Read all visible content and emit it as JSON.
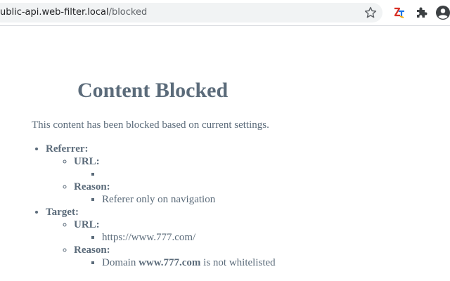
{
  "browser": {
    "url_host": "ublic-api.web-filter.local",
    "url_path": "/blocked",
    "icons": [
      "star-icon",
      "extension-icon",
      "puzzle-icon",
      "profile-icon"
    ]
  },
  "page": {
    "title": "Content Blocked",
    "description": "This content has been blocked based on current settings.",
    "referrer_label": "Referrer:",
    "referrer_url_label": "URL:",
    "referrer_url_value": "",
    "referrer_reason_label": "Reason:",
    "referrer_reason_value": "Referer only on navigation",
    "target_label": "Target:",
    "target_url_label": "URL:",
    "target_url_value": "https://www.777.com/",
    "target_reason_label": "Reason:",
    "target_reason_prefix": "Domain",
    "target_reason_domain": "www.777.com",
    "target_reason_suffix": "is not whitelisted"
  },
  "colors": {
    "text": "#5b6b7a",
    "omnibox_bg": "#f1f3f4"
  }
}
